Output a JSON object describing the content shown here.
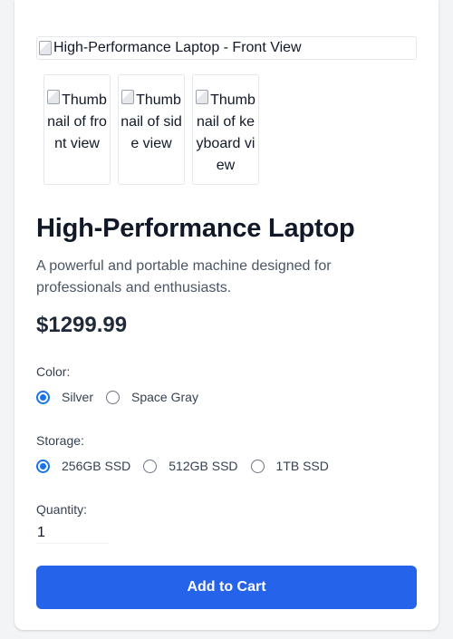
{
  "product": {
    "main_image_alt": "High-Performance Laptop - Front View",
    "thumbnails": [
      {
        "alt": "Thumbnail of front view"
      },
      {
        "alt": "Thumbnail of side view"
      },
      {
        "alt": "Thumbnail of keyboard view"
      }
    ],
    "title": "High-Performance Laptop",
    "description": "A powerful and portable machine designed for professionals and enthusiasts.",
    "price": "$1299.99"
  },
  "options": {
    "color": {
      "label": "Color:",
      "choices": [
        "Silver",
        "Space Gray"
      ],
      "selected": "Silver"
    },
    "storage": {
      "label": "Storage:",
      "choices": [
        "256GB SSD",
        "512GB SSD",
        "1TB SSD"
      ],
      "selected": "256GB SSD"
    },
    "quantity": {
      "label": "Quantity:",
      "value": "1"
    }
  },
  "actions": {
    "add_to_cart_label": "Add to Cart"
  },
  "colors": {
    "accent": "#2563eb",
    "radio_checked": "#1a73e8",
    "page_bg": "#f3f4f6"
  }
}
